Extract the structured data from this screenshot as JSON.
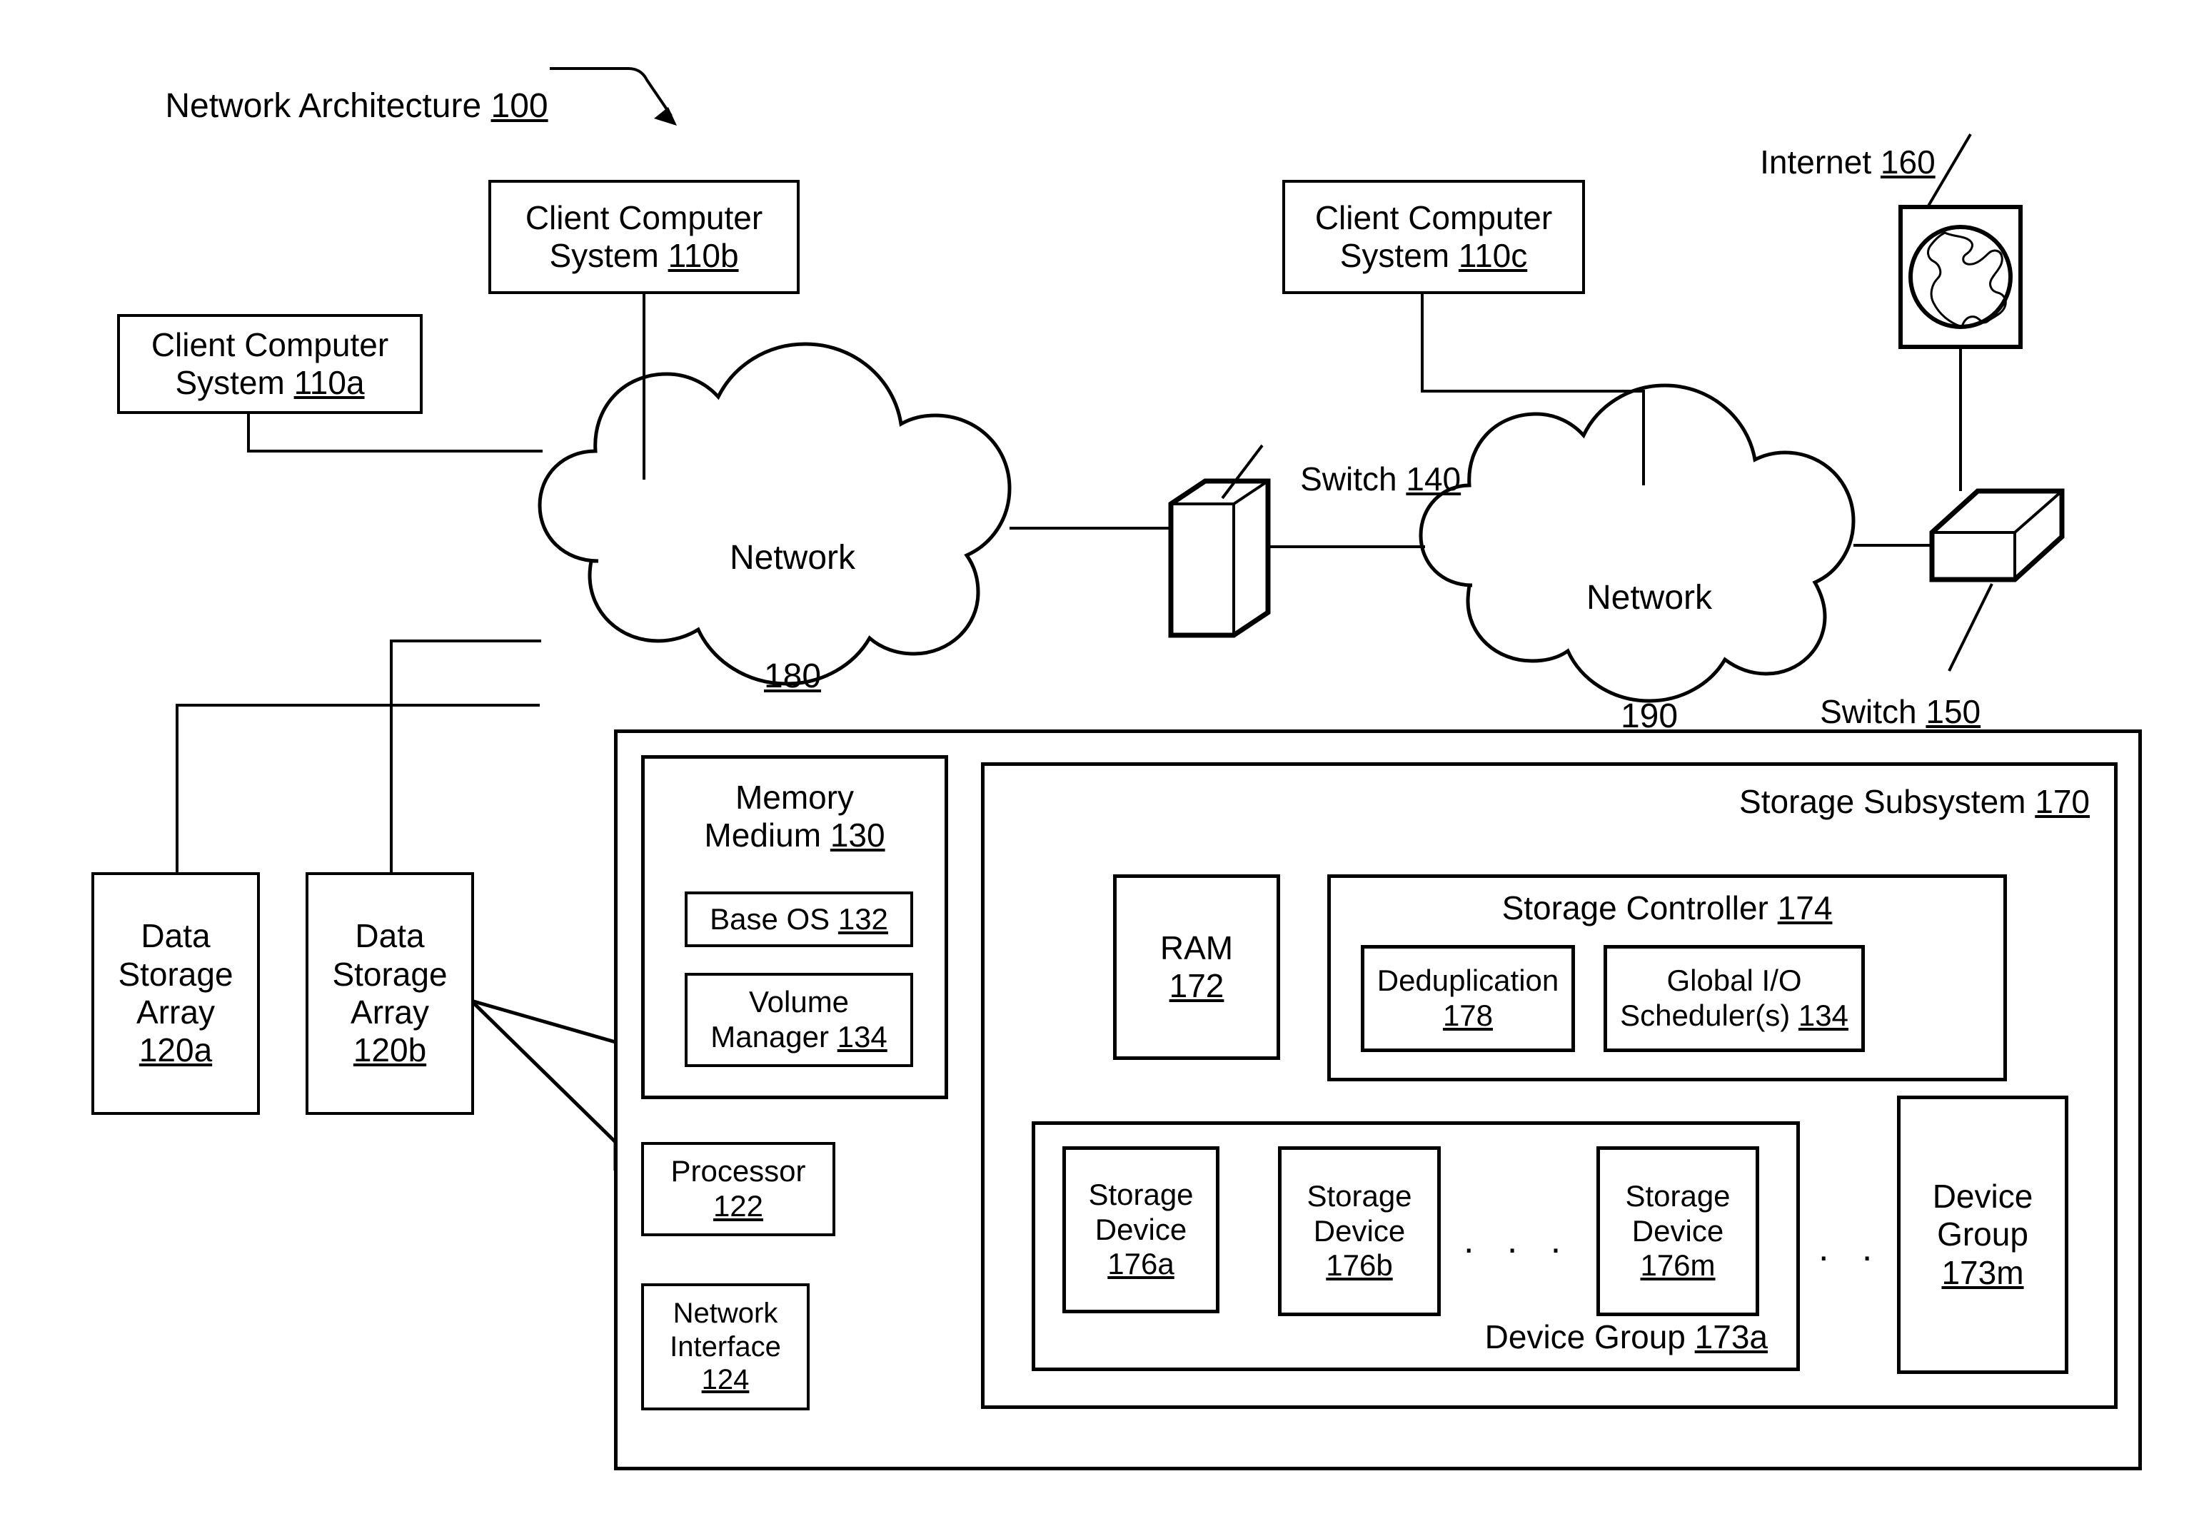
{
  "figure": {
    "title": "Network Architecture 100",
    "title_main": "Network Architecture ",
    "title_ref": "100"
  },
  "clients": [
    {
      "name": "client-110a",
      "line1": "Client Computer",
      "line2": "System ",
      "ref": "110a"
    },
    {
      "name": "client-110b",
      "line1": "Client Computer",
      "line2": "System ",
      "ref": "110b"
    },
    {
      "name": "client-110c",
      "line1": "Client Computer",
      "line2": "System ",
      "ref": "110c"
    }
  ],
  "networks": [
    {
      "name": "network-180",
      "label": "Network",
      "ref": "180"
    },
    {
      "name": "network-190",
      "label": "Network",
      "ref": "190"
    }
  ],
  "switches": [
    {
      "name": "switch-140",
      "label": "Switch ",
      "ref": "140"
    },
    {
      "name": "switch-150",
      "label": "Switch ",
      "ref": "150"
    }
  ],
  "internet": {
    "label": "Internet ",
    "ref": "160"
  },
  "storage_arrays": [
    {
      "name": "data-storage-array-120a",
      "line1": "Data",
      "line2": "Storage",
      "line3": "Array",
      "ref": "120a"
    },
    {
      "name": "data-storage-array-120b",
      "line1": "Data",
      "line2": "Storage",
      "line3": "Array",
      "ref": "120b"
    }
  ],
  "memory_medium": {
    "line1": "Memory",
    "line2": "Medium ",
    "ref": "130",
    "children": [
      {
        "name": "base-os-132",
        "label": "Base OS ",
        "ref": "132"
      },
      {
        "name": "volume-manager-134",
        "line1": "Volume",
        "line2": "Manager ",
        "ref": "134"
      }
    ]
  },
  "processor": {
    "label": "Processor",
    "ref": "122"
  },
  "network_interface": {
    "line1": "Network",
    "line2": "Interface",
    "ref": "124"
  },
  "storage_subsystem": {
    "label": "Storage Subsystem ",
    "ref": "170",
    "ram": {
      "label": "RAM",
      "ref": "172"
    },
    "storage_controller": {
      "label": "Storage Controller ",
      "ref": "174",
      "modules": [
        {
          "name": "deduplication-178",
          "label": "Deduplication",
          "ref": "178"
        },
        {
          "name": "global-io-scheduler-134",
          "line1": "Global I/O",
          "line2": "Scheduler(s) ",
          "ref": "134"
        }
      ]
    },
    "device_group_a": {
      "label": "Device Group ",
      "ref": "173a",
      "devices": [
        {
          "name": "storage-device-176a",
          "line1": "Storage",
          "line2": "Device",
          "ref": "176a"
        },
        {
          "name": "storage-device-176b",
          "line1": "Storage",
          "line2": "Device",
          "ref": "176b"
        },
        {
          "name": "storage-device-176m",
          "line1": "Storage",
          "line2": "Device",
          "ref": "176m"
        }
      ],
      "ellipsis": ". . ."
    },
    "device_group_m": {
      "line1": "Device",
      "line2": "Group",
      "ref": "173m"
    },
    "ellipsis_outer": ". . ."
  }
}
